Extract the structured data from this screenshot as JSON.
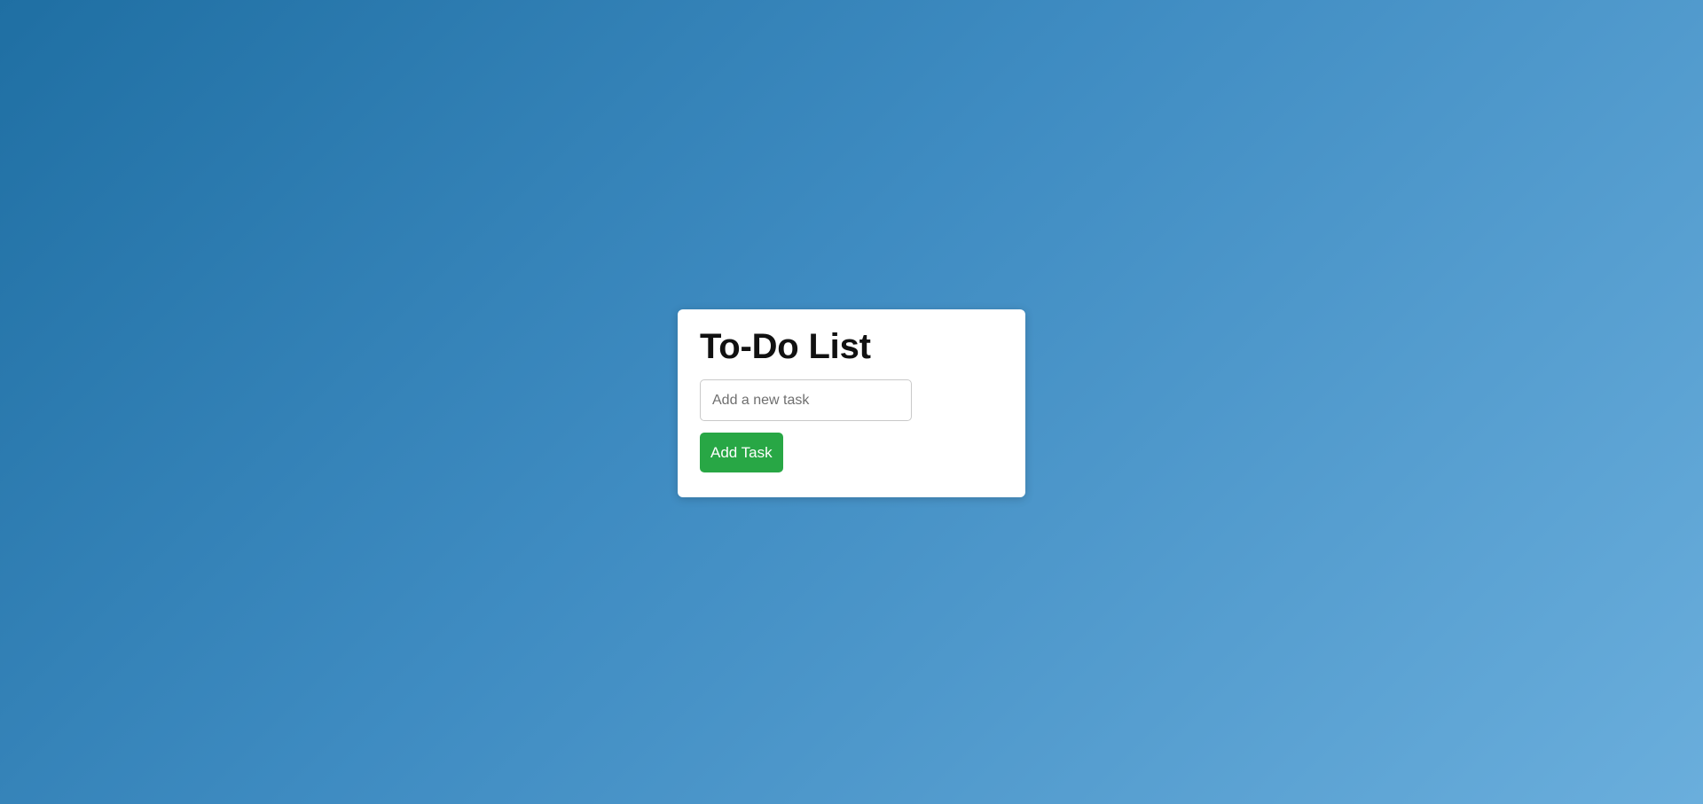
{
  "todo": {
    "title": "To-Do List",
    "input": {
      "value": "",
      "placeholder": "Add a new task"
    },
    "add_button_label": "Add Task"
  },
  "colors": {
    "background_start": "#1f6fa3",
    "background_end": "#6aaedc",
    "card": "#ffffff",
    "button": "#28a745",
    "button_text": "#ffffff"
  }
}
